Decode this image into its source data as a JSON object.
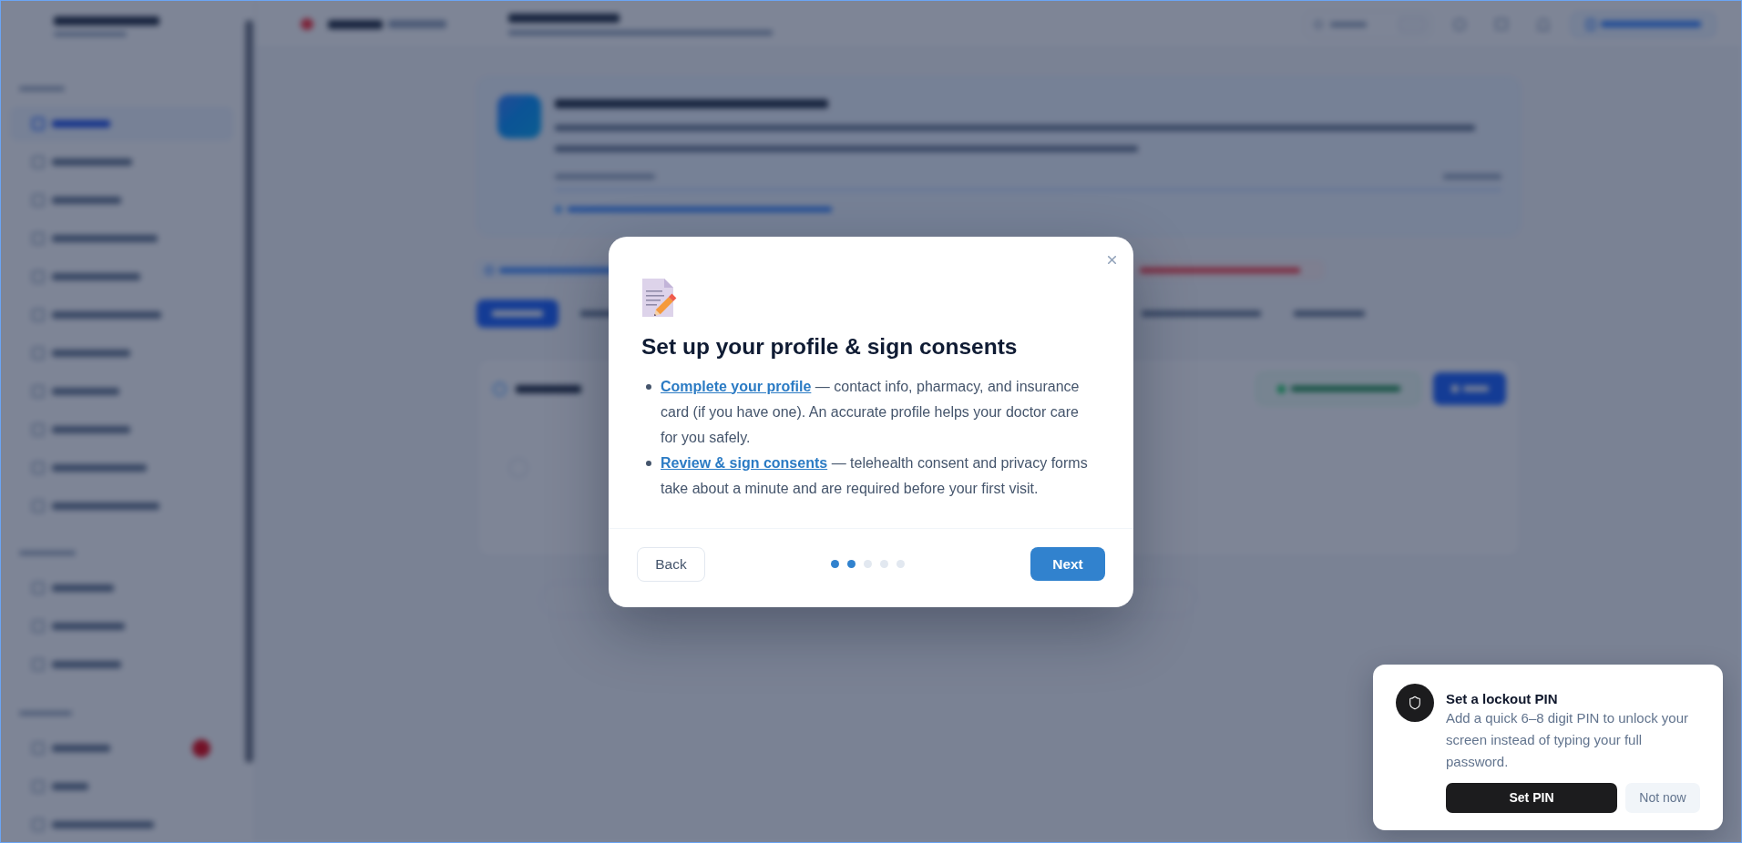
{
  "modal": {
    "title": "Set up your profile & sign consents",
    "items": [
      {
        "link": "Complete your profile",
        "text": "— contact info, pharmacy, and insurance card (if you have one). An accurate profile helps your doctor care for you safely."
      },
      {
        "link": "Review & sign consents",
        "text": "— telehealth consent and privacy forms take about a minute and are required before your first visit."
      }
    ],
    "back_button": "Back",
    "next_button": "Next",
    "steps": [
      {
        "filled": true
      },
      {
        "filled": true
      },
      {
        "filled": false
      },
      {
        "filled": false
      },
      {
        "filled": false
      }
    ]
  },
  "toast": {
    "title": "Set a lockout PIN",
    "body": "Add a quick 6–8 digit PIN to unlock your screen instead of typing your full password.",
    "primary_button": "Set PIN",
    "secondary_button": "Not now"
  }
}
